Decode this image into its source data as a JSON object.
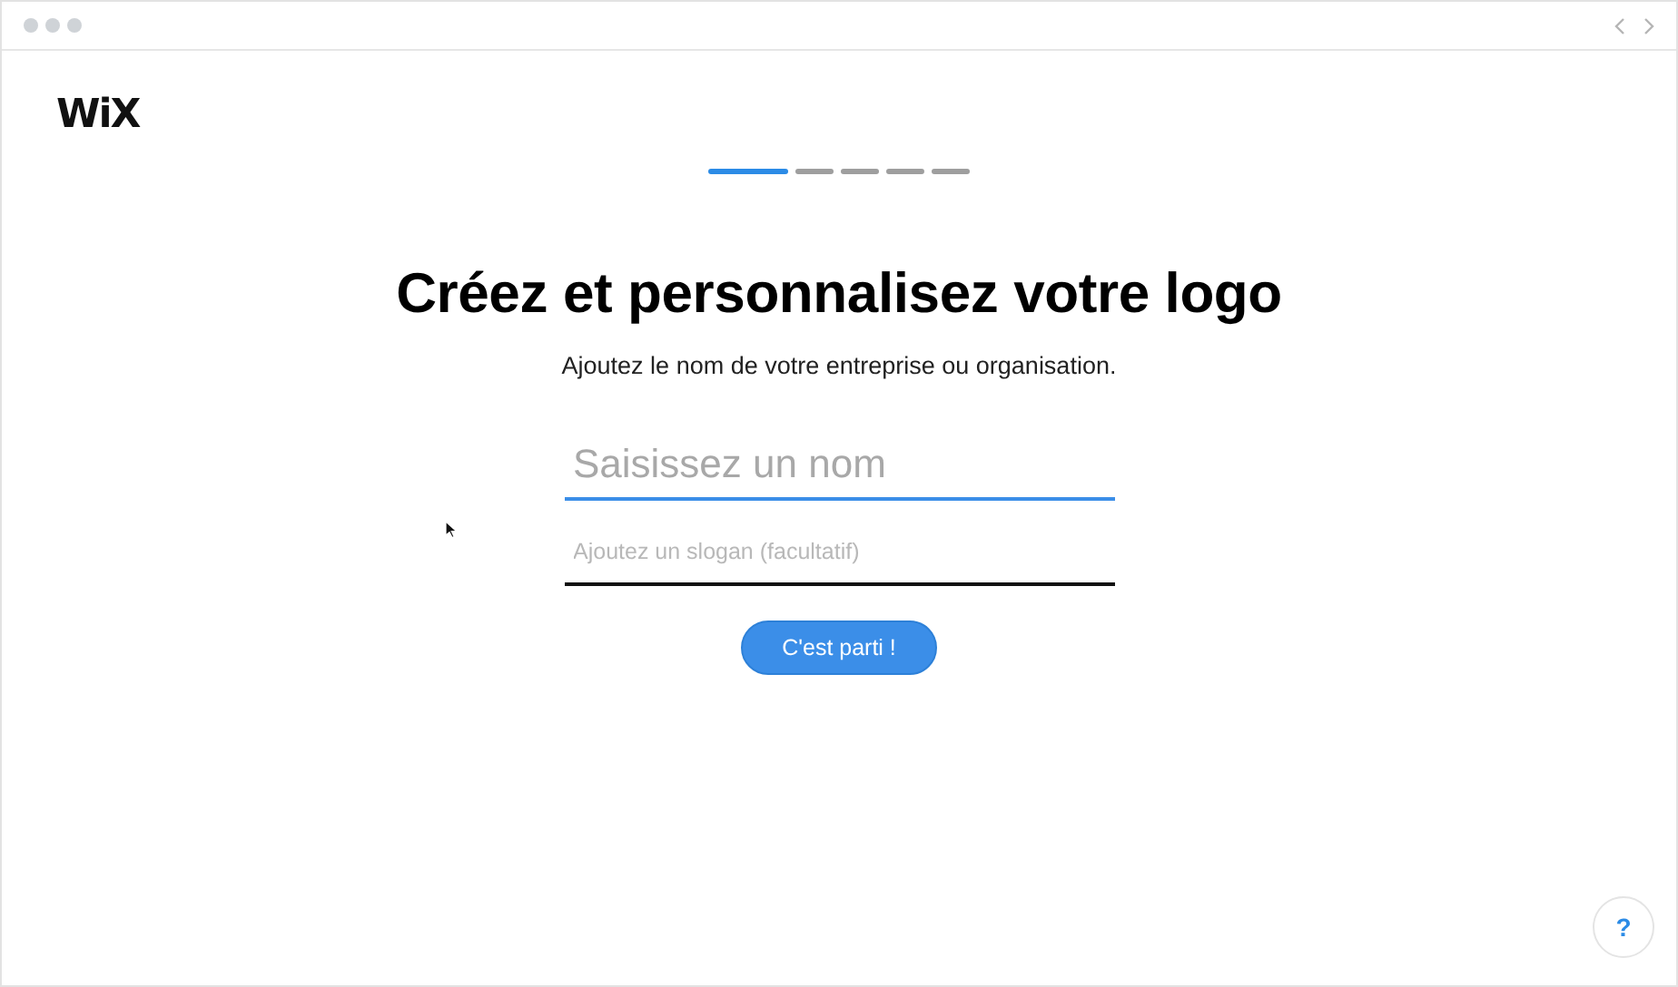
{
  "logo": "WiX",
  "steps": [
    {
      "selected": true
    },
    {
      "selected": false
    },
    {
      "selected": false
    },
    {
      "selected": false
    },
    {
      "selected": false
    }
  ],
  "heading": "Créez et personnalisez votre logo",
  "subtitle": "Ajoutez le nom de votre entreprise ou organisation.",
  "fields": [
    {
      "placeholder": "Saisissez un nom",
      "focused": true,
      "kind": "large"
    },
    {
      "placeholder": "Ajoutez un slogan (facultatif)",
      "focused": false,
      "kind": "small"
    }
  ],
  "submit_button": "C'est parti !",
  "help_button": "?"
}
